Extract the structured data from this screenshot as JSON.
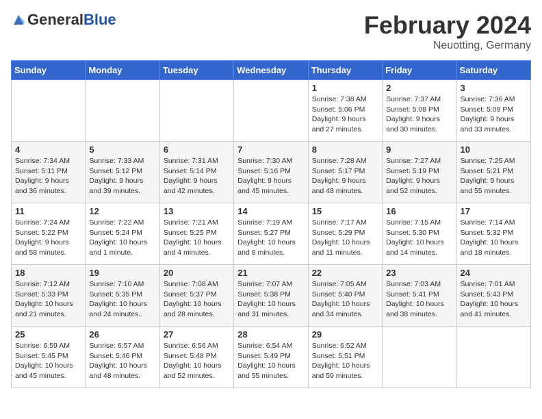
{
  "header": {
    "logo_general": "General",
    "logo_blue": "Blue",
    "month_title": "February 2024",
    "location": "Neuotting, Germany"
  },
  "weekdays": [
    "Sunday",
    "Monday",
    "Tuesday",
    "Wednesday",
    "Thursday",
    "Friday",
    "Saturday"
  ],
  "weeks": [
    [
      {
        "day": "",
        "info": ""
      },
      {
        "day": "",
        "info": ""
      },
      {
        "day": "",
        "info": ""
      },
      {
        "day": "",
        "info": ""
      },
      {
        "day": "1",
        "info": "Sunrise: 7:38 AM\nSunset: 5:06 PM\nDaylight: 9 hours\nand 27 minutes."
      },
      {
        "day": "2",
        "info": "Sunrise: 7:37 AM\nSunset: 5:08 PM\nDaylight: 9 hours\nand 30 minutes."
      },
      {
        "day": "3",
        "info": "Sunrise: 7:36 AM\nSunset: 5:09 PM\nDaylight: 9 hours\nand 33 minutes."
      }
    ],
    [
      {
        "day": "4",
        "info": "Sunrise: 7:34 AM\nSunset: 5:11 PM\nDaylight: 9 hours\nand 36 minutes."
      },
      {
        "day": "5",
        "info": "Sunrise: 7:33 AM\nSunset: 5:12 PM\nDaylight: 9 hours\nand 39 minutes."
      },
      {
        "day": "6",
        "info": "Sunrise: 7:31 AM\nSunset: 5:14 PM\nDaylight: 9 hours\nand 42 minutes."
      },
      {
        "day": "7",
        "info": "Sunrise: 7:30 AM\nSunset: 5:16 PM\nDaylight: 9 hours\nand 45 minutes."
      },
      {
        "day": "8",
        "info": "Sunrise: 7:28 AM\nSunset: 5:17 PM\nDaylight: 9 hours\nand 48 minutes."
      },
      {
        "day": "9",
        "info": "Sunrise: 7:27 AM\nSunset: 5:19 PM\nDaylight: 9 hours\nand 52 minutes."
      },
      {
        "day": "10",
        "info": "Sunrise: 7:25 AM\nSunset: 5:21 PM\nDaylight: 9 hours\nand 55 minutes."
      }
    ],
    [
      {
        "day": "11",
        "info": "Sunrise: 7:24 AM\nSunset: 5:22 PM\nDaylight: 9 hours\nand 58 minutes."
      },
      {
        "day": "12",
        "info": "Sunrise: 7:22 AM\nSunset: 5:24 PM\nDaylight: 10 hours\nand 1 minute."
      },
      {
        "day": "13",
        "info": "Sunrise: 7:21 AM\nSunset: 5:25 PM\nDaylight: 10 hours\nand 4 minutes."
      },
      {
        "day": "14",
        "info": "Sunrise: 7:19 AM\nSunset: 5:27 PM\nDaylight: 10 hours\nand 8 minutes."
      },
      {
        "day": "15",
        "info": "Sunrise: 7:17 AM\nSunset: 5:29 PM\nDaylight: 10 hours\nand 11 minutes."
      },
      {
        "day": "16",
        "info": "Sunrise: 7:15 AM\nSunset: 5:30 PM\nDaylight: 10 hours\nand 14 minutes."
      },
      {
        "day": "17",
        "info": "Sunrise: 7:14 AM\nSunset: 5:32 PM\nDaylight: 10 hours\nand 18 minutes."
      }
    ],
    [
      {
        "day": "18",
        "info": "Sunrise: 7:12 AM\nSunset: 5:33 PM\nDaylight: 10 hours\nand 21 minutes."
      },
      {
        "day": "19",
        "info": "Sunrise: 7:10 AM\nSunset: 5:35 PM\nDaylight: 10 hours\nand 24 minutes."
      },
      {
        "day": "20",
        "info": "Sunrise: 7:08 AM\nSunset: 5:37 PM\nDaylight: 10 hours\nand 28 minutes."
      },
      {
        "day": "21",
        "info": "Sunrise: 7:07 AM\nSunset: 5:38 PM\nDaylight: 10 hours\nand 31 minutes."
      },
      {
        "day": "22",
        "info": "Sunrise: 7:05 AM\nSunset: 5:40 PM\nDaylight: 10 hours\nand 34 minutes."
      },
      {
        "day": "23",
        "info": "Sunrise: 7:03 AM\nSunset: 5:41 PM\nDaylight: 10 hours\nand 38 minutes."
      },
      {
        "day": "24",
        "info": "Sunrise: 7:01 AM\nSunset: 5:43 PM\nDaylight: 10 hours\nand 41 minutes."
      }
    ],
    [
      {
        "day": "25",
        "info": "Sunrise: 6:59 AM\nSunset: 5:45 PM\nDaylight: 10 hours\nand 45 minutes."
      },
      {
        "day": "26",
        "info": "Sunrise: 6:57 AM\nSunset: 5:46 PM\nDaylight: 10 hours\nand 48 minutes."
      },
      {
        "day": "27",
        "info": "Sunrise: 6:56 AM\nSunset: 5:48 PM\nDaylight: 10 hours\nand 52 minutes."
      },
      {
        "day": "28",
        "info": "Sunrise: 6:54 AM\nSunset: 5:49 PM\nDaylight: 10 hours\nand 55 minutes."
      },
      {
        "day": "29",
        "info": "Sunrise: 6:52 AM\nSunset: 5:51 PM\nDaylight: 10 hours\nand 59 minutes."
      },
      {
        "day": "",
        "info": ""
      },
      {
        "day": "",
        "info": ""
      }
    ]
  ]
}
